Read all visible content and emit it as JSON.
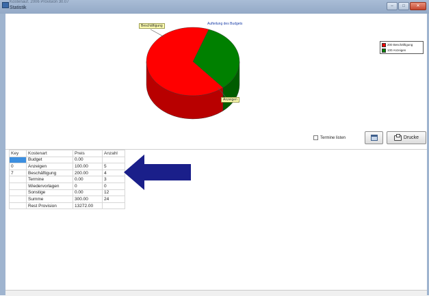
{
  "window": {
    "title": "Statistik",
    "ghost_title": "Kostenauf. 2006 Provision 30.07",
    "minimize_label": "–",
    "maximize_label": "□",
    "close_label": "✕"
  },
  "chart_data": {
    "type": "pie",
    "title": "Aufteilung des Budgets",
    "categories": [
      "Beschäftigung",
      "Anzeigen"
    ],
    "values": [
      200,
      100
    ],
    "colors": [
      "#ff0000",
      "#008000"
    ],
    "legend": [
      "200 Beschäftigung",
      "100 Anzeigen"
    ],
    "legend_placement": "top-right"
  },
  "toolbar": {
    "termine_label": "Termine listen",
    "print_label": "Drucke"
  },
  "table": {
    "headers": [
      "Key",
      "Kostenart",
      "Preis",
      "Anzahl"
    ],
    "rows": [
      {
        "key": "",
        "kostenart": "Budget",
        "preis": "0.00",
        "anzahl": ""
      },
      {
        "key": "0",
        "kostenart": "Anzeigen",
        "preis": "100.00",
        "anzahl": "5"
      },
      {
        "key": "7",
        "kostenart": "Beschäftigung",
        "preis": "200.00",
        "anzahl": "4"
      },
      {
        "key": "",
        "kostenart": "Termine",
        "preis": "0.00",
        "anzahl": "3"
      },
      {
        "key": "",
        "kostenart": "Wiedervorlagen",
        "preis": "0",
        "anzahl": "0"
      },
      {
        "key": "",
        "kostenart": "Sonstige",
        "preis": "0.00",
        "anzahl": "12"
      },
      {
        "key": "",
        "kostenart": "Summe",
        "preis": "300.00",
        "anzahl": "24"
      },
      {
        "key": "",
        "kostenart": "Rest Provision",
        "preis": "13272.00",
        "anzahl": ""
      }
    ]
  },
  "annotation": {
    "arrow_color": "#1a1f8a"
  }
}
